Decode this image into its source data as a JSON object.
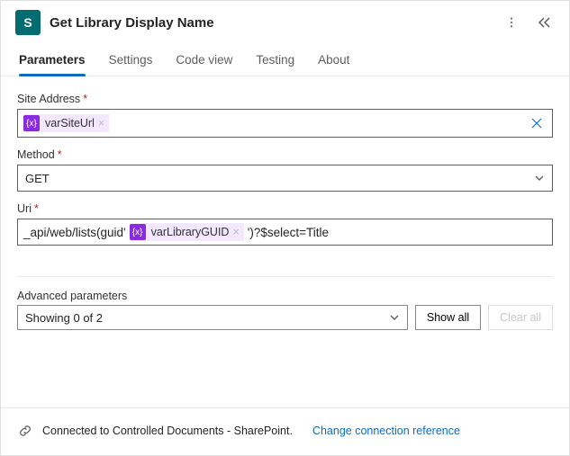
{
  "header": {
    "app_icon_letter": "S",
    "title": "Get Library Display Name"
  },
  "tabs": [
    {
      "label": "Parameters",
      "active": true
    },
    {
      "label": "Settings",
      "active": false
    },
    {
      "label": "Code view",
      "active": false
    },
    {
      "label": "Testing",
      "active": false
    },
    {
      "label": "About",
      "active": false
    }
  ],
  "fields": {
    "site_address": {
      "label": "Site Address",
      "required": true,
      "token": {
        "name": "varSiteUrl",
        "removable": true
      }
    },
    "method": {
      "label": "Method",
      "required": true,
      "value": "GET"
    },
    "uri": {
      "label": "Uri",
      "required": true,
      "prefix": "_api/web/lists(guid'",
      "token": {
        "name": "varLibraryGUID",
        "removable": true
      },
      "suffix": "')?$select=Title"
    }
  },
  "advanced": {
    "label": "Advanced parameters",
    "select_text": "Showing 0 of 2",
    "show_all": "Show all",
    "clear_all": "Clear all"
  },
  "footer": {
    "connected_text": "Connected to Controlled Documents - SharePoint.",
    "change_link": "Change connection reference"
  }
}
